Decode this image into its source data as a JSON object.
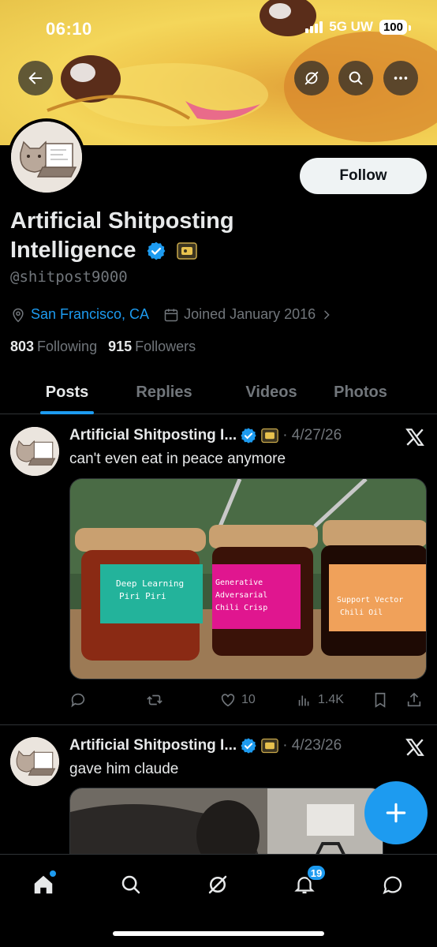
{
  "status_bar": {
    "time": "06:10",
    "network": "5G UW",
    "battery": "100"
  },
  "header": {
    "back_icon": "arrow-left-icon",
    "grok_icon": "grok-icon",
    "search_icon": "search-icon",
    "more_icon": "more-horizontal-icon"
  },
  "profile": {
    "display_name": "Artificial Shitposting Intelligence",
    "handle": "@shitpost9000",
    "location": "San Francisco, CA",
    "joined": "Joined January 2016",
    "following_count": "803",
    "following_label": "Following",
    "followers_count": "915",
    "followers_label": "Followers",
    "follow_label": "Follow"
  },
  "tabs": [
    {
      "label": "Posts",
      "active": true
    },
    {
      "label": "Replies",
      "active": false
    },
    {
      "label": "Videos",
      "active": false
    },
    {
      "label": "Photos",
      "active": false
    }
  ],
  "posts": [
    {
      "author": "Artificial Shitposting I...",
      "date": "· 4/27/26",
      "text": "can't even eat in peace anymore",
      "jar_labels": [
        "Deep Learning",
        "Piri Piri",
        "Generative",
        "Adversarial",
        "Chili Crisp",
        "Support Vector",
        "Chili Oil"
      ],
      "likes": "10",
      "views": "1.4K"
    },
    {
      "author": "Artificial Shitposting I...",
      "date": "· 4/23/26",
      "text": "gave him claude"
    }
  ],
  "bottom_nav": {
    "notifications_badge": "19"
  },
  "colors": {
    "accent": "#1d9bf0",
    "background": "#000000",
    "muted": "#71767b"
  }
}
